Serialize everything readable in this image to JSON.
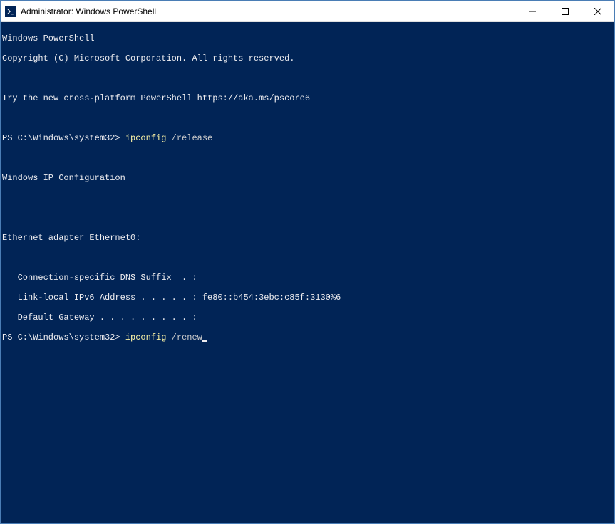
{
  "window": {
    "title": "Administrator: Windows PowerShell"
  },
  "terminal": {
    "header1": "Windows PowerShell",
    "header2": "Copyright (C) Microsoft Corporation. All rights reserved.",
    "tryline": "Try the new cross-platform PowerShell https://aka.ms/pscore6",
    "prompt1_prefix": "PS C:\\Windows\\system32> ",
    "prompt1_cmd": "ipconfig ",
    "prompt1_arg": "/release",
    "output_header": "Windows IP Configuration",
    "adapter_header": "Ethernet adapter Ethernet0:",
    "line_dns": "   Connection-specific DNS Suffix  . :",
    "line_ipv6": "   Link-local IPv6 Address . . . . . : fe80::b454:3ebc:c85f:3130%6",
    "line_gateway": "   Default Gateway . . . . . . . . . :",
    "prompt2_prefix": "PS C:\\Windows\\system32> ",
    "prompt2_cmd": "ipconfig ",
    "prompt2_arg": "/renew"
  }
}
